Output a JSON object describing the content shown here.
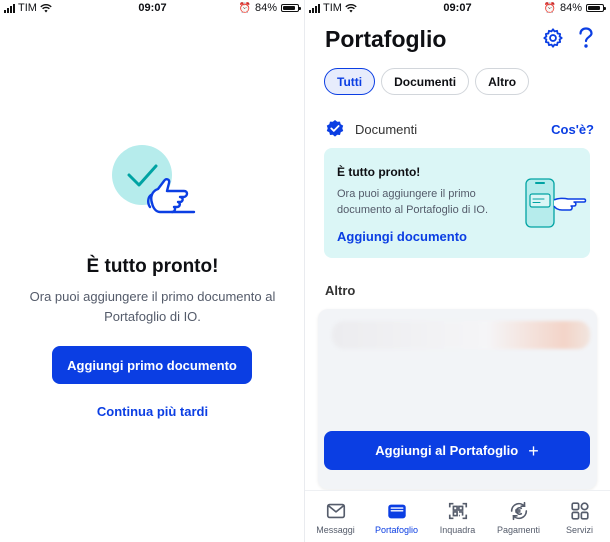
{
  "left_screen": {
    "status": {
      "carrier": "TIM",
      "time": "09:07",
      "battery": "84%"
    },
    "title": "È tutto pronto!",
    "subtitle": "Ora puoi aggiungere il primo documento al Portafoglio di IO.",
    "primary_button": "Aggiungi primo documento",
    "secondary_link": "Continua più tardi"
  },
  "right_screen": {
    "status": {
      "carrier": "TIM",
      "time": "09:07",
      "battery": "84%"
    },
    "title": "Portafoglio",
    "filters": [
      {
        "label": "Tutti",
        "selected": true
      },
      {
        "label": "Documenti",
        "selected": false
      },
      {
        "label": "Altro",
        "selected": false
      }
    ],
    "documents_section": {
      "label": "Documenti",
      "info_link": "Cos'è?"
    },
    "banner": {
      "title": "È tutto pronto!",
      "text": "Ora puoi aggiungere il primo documento al Portafoglio di IO.",
      "link": "Aggiungi documento"
    },
    "altro_label": "Altro",
    "add_button": "Aggiungi al Portafoglio",
    "tabs": [
      {
        "label": "Messaggi",
        "icon": "envelope-icon",
        "active": false
      },
      {
        "label": "Portafoglio",
        "icon": "wallet-icon",
        "active": true
      },
      {
        "label": "Inquadra",
        "icon": "qr-scan-icon",
        "active": false
      },
      {
        "label": "Pagamenti",
        "icon": "euro-cycle-icon",
        "active": false
      },
      {
        "label": "Servizi",
        "icon": "grid-icon",
        "active": false
      }
    ]
  },
  "colors": {
    "accent": "#0b3ee3",
    "banner_bg": "#dbf6f6",
    "illustration_turquoise": "#b6ecec"
  }
}
